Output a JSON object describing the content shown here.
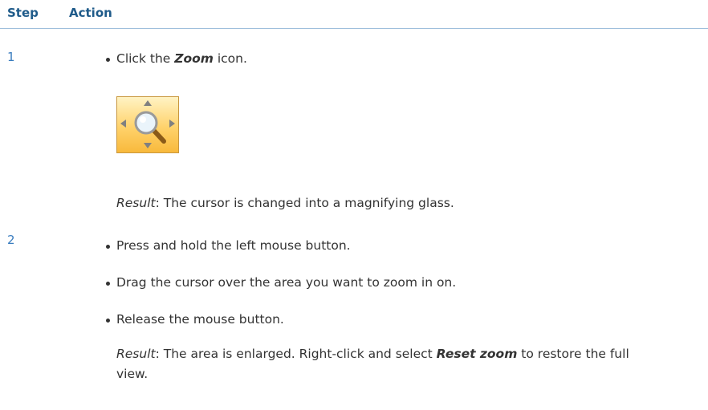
{
  "header": {
    "step_label": "Step",
    "action_label": "Action"
  },
  "steps": [
    {
      "number": "1",
      "bullets": [
        {
          "pre": "Click the ",
          "bold": "Zoom",
          "post": " icon."
        }
      ],
      "icon": "zoom-icon",
      "result": {
        "label": "Result",
        "text": ": The cursor is changed into a magnifying glass."
      }
    },
    {
      "number": "2",
      "bullets": [
        {
          "text": "Press and hold the left mouse button."
        },
        {
          "text": "Drag the cursor over the area you want to zoom in on."
        },
        {
          "text": "Release the mouse button."
        }
      ],
      "result": {
        "label": "Result",
        "pre": ": The area is enlarged. Right-click and select ",
        "bold": "Reset zoom",
        "post": " to restore the full view."
      }
    }
  ],
  "colors": {
    "header_text": "#1f5b8a",
    "step_number": "#3a7dbf",
    "rule": "#9fbfdc",
    "icon_bg": "#ffd26b"
  }
}
